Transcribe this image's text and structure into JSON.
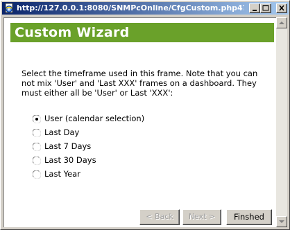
{
  "window": {
    "title": "http://127.0.0.1:8080/SNMPcOnline/CfgCustom.php4?...",
    "icon": "ie-page-icon",
    "caption_buttons": [
      "minimize",
      "maximize",
      "close"
    ]
  },
  "header": {
    "title": "Custom Wizard",
    "band_color": "#6aa12a"
  },
  "instructions": "Select the timeframe used in this frame. Note that you can not mix 'User' and 'Last XXX' frames on a dashboard. They must either all be 'User' or Last 'XXX':",
  "options": [
    {
      "label": "User (calendar selection)",
      "selected": true
    },
    {
      "label": "Last Day",
      "selected": false
    },
    {
      "label": "Last 7 Days",
      "selected": false
    },
    {
      "label": "Last 30 Days",
      "selected": false
    },
    {
      "label": "Last Year",
      "selected": false
    }
  ],
  "buttons": {
    "back": "< Back",
    "next": "Next >",
    "finish": "Finshed"
  }
}
